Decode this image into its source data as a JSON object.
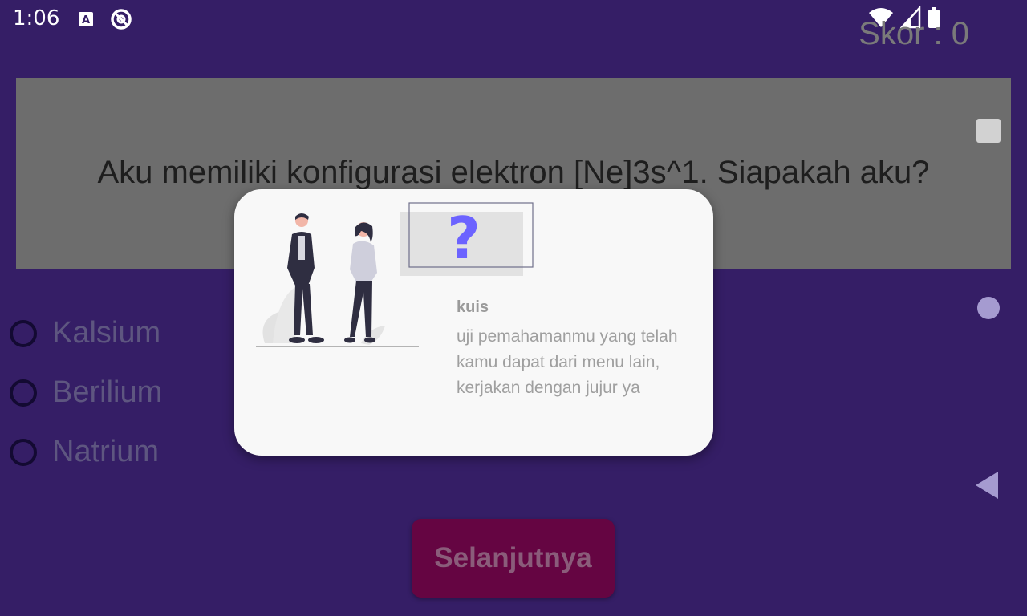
{
  "status_bar": {
    "time": "1:06",
    "icons_left": [
      "a-box-icon",
      "no-entry-circle-icon"
    ],
    "icons_right": [
      "wifi-icon",
      "signal-icon",
      "battery-icon"
    ]
  },
  "score": {
    "label": "Skor : 0"
  },
  "question": {
    "text": "Aku memiliki konfigurasi elektron [Ne]3s^1. Siapakah aku?"
  },
  "options": [
    {
      "label": "Kalsium",
      "selected": false
    },
    {
      "label": "Berilium",
      "selected": false
    },
    {
      "label": "Natrium",
      "selected": false
    }
  ],
  "next_button": {
    "label": "Selanjutnya"
  },
  "dialog": {
    "title": "kuis",
    "body": "uji pemahamanmu yang telah kamu dapat dari menu lain, kerjakan dengan jujur ya",
    "illustration": "people-question-mark-illustration",
    "question_mark": "?"
  },
  "colors": {
    "background": "#351e66",
    "question_card": "#6d6d6d",
    "next_button": "#650542",
    "accent_question": "#6c63ff",
    "dialog": "#f8f8f8"
  }
}
